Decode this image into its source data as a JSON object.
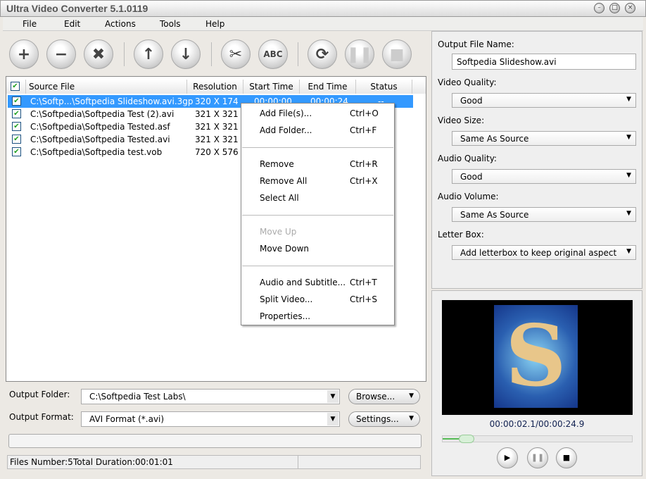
{
  "window": {
    "title": "Ultra Video Converter 5.1.0119"
  },
  "menu": [
    "File",
    "Edit",
    "Actions",
    "Tools",
    "Help"
  ],
  "toolbar": [
    {
      "icon": "add-icon",
      "g": "+"
    },
    {
      "icon": "remove-icon",
      "g": "−"
    },
    {
      "icon": "clear-icon",
      "g": "✖"
    },
    {
      "icon": "move-up-icon",
      "g": "↑"
    },
    {
      "icon": "move-down-icon",
      "g": "↓"
    },
    {
      "icon": "split-icon",
      "g": "✂"
    },
    {
      "icon": "rename-icon",
      "g": "ABC"
    },
    {
      "icon": "convert-icon",
      "g": "⟳"
    },
    {
      "icon": "pause-icon",
      "g": "❚❚"
    },
    {
      "icon": "stop-icon",
      "g": "■"
    }
  ],
  "list": {
    "columns": [
      "Source File",
      "Resolution",
      "Start Time",
      "End Time",
      "Status"
    ],
    "rows": [
      {
        "file": "C:\\Softp...\\Softpedia Slideshow.avi.3gp",
        "res": "320 X 174",
        "start": "00:00:00",
        "end": "00:00:24",
        "status": "--"
      },
      {
        "file": "C:\\Softpedia\\Softpedia Test (2).avi",
        "res": "321 X 321"
      },
      {
        "file": "C:\\Softpedia\\Softpedia Tested.asf",
        "res": "321 X 321"
      },
      {
        "file": "C:\\Softpedia\\Softpedia Tested.avi",
        "res": "321 X 321"
      },
      {
        "file": "C:\\Softpedia\\Softpedia test.vob",
        "res": "720 X 576"
      }
    ]
  },
  "context_menu": [
    {
      "label": "Add File(s)...",
      "key": "Ctrl+O"
    },
    {
      "label": "Add Folder...",
      "key": "Ctrl+F"
    },
    {
      "label": "Remove",
      "key": "Ctrl+R"
    },
    {
      "label": "Remove All",
      "key": "Ctrl+X"
    },
    {
      "label": "Select All",
      "key": ""
    },
    {
      "label": "Move Up",
      "key": "",
      "disabled": true
    },
    {
      "label": "Move Down",
      "key": ""
    },
    {
      "label": "Audio and Subtitle...",
      "key": "Ctrl+T"
    },
    {
      "label": "Split Video...",
      "key": "Ctrl+S"
    },
    {
      "label": "Properties...",
      "key": ""
    }
  ],
  "settings": {
    "output_name_label": "Output File Name:",
    "output_name": "Softpedia Slideshow.avi",
    "fields": [
      {
        "label": "Video Quality:",
        "value": "Good"
      },
      {
        "label": "Video Size:",
        "value": "Same As Source"
      },
      {
        "label": "Audio Quality:",
        "value": "Good"
      },
      {
        "label": "Audio Volume:",
        "value": "Same As Source"
      },
      {
        "label": "Letter Box:",
        "value": "Add letterbox to keep original aspect"
      }
    ]
  },
  "preview": {
    "time": "00:00:02.1/00:00:24.9",
    "progress": 0.085
  },
  "bottom": {
    "folder_label": "Output Folder:",
    "folder": "C:\\Softpedia Test Labs\\",
    "browse": "Browse...",
    "format_label": "Output Format:",
    "format": "AVI Format (*.avi)",
    "settings": "Settings..."
  },
  "status": {
    "files": "Files Number:5",
    "duration": "Total Duration:00:01:01"
  }
}
